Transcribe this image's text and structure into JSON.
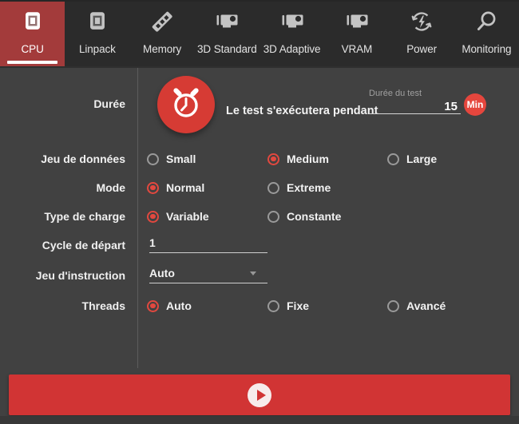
{
  "app": {
    "name": "stress-test-tool"
  },
  "colors": {
    "tab_selected_red": "#a33b3b",
    "accent_red": "#d13434",
    "alarm_red": "#d63b34",
    "min_button_red": "#e5463d",
    "radio_red": "#e2483f",
    "background": "#414141",
    "tabbar_background": "#2b2b2b"
  },
  "tabs": [
    {
      "label": "CPU",
      "icon": "cpu-chip",
      "selected": true
    },
    {
      "label": "Linpack",
      "icon": "chip",
      "selected": false
    },
    {
      "label": "Memory",
      "icon": "ram-stick",
      "selected": false
    },
    {
      "label": "3D Standard",
      "icon": "gpu-card",
      "selected": false
    },
    {
      "label": "3D Adaptive",
      "icon": "gpu-card",
      "selected": false
    },
    {
      "label": "VRAM",
      "icon": "gpu-card",
      "selected": false
    },
    {
      "label": "Power",
      "icon": "power-cycle",
      "selected": false
    },
    {
      "label": "Monitoring",
      "icon": "magnifier",
      "selected": false
    }
  ],
  "form": {
    "duration": {
      "label": "Durée",
      "description": "Le test s'exécutera pendant",
      "field_label": "Durée du test",
      "value": "15",
      "unit": "Min"
    },
    "rows": [
      {
        "label": "Jeu de données",
        "type": "radio",
        "options": [
          {
            "label": "Small",
            "selected": false
          },
          {
            "label": "Medium",
            "selected": true
          },
          {
            "label": "Large",
            "selected": false
          }
        ]
      },
      {
        "label": "Mode",
        "type": "radio",
        "options": [
          {
            "label": "Normal",
            "selected": true
          },
          {
            "label": "Extreme",
            "selected": false
          }
        ]
      },
      {
        "label": "Type de charge",
        "type": "radio",
        "options": [
          {
            "label": "Variable",
            "selected": true
          },
          {
            "label": "Constante",
            "selected": false
          }
        ]
      },
      {
        "label": "Cycle de départ",
        "type": "input",
        "value": "1"
      },
      {
        "label": "Jeu d'instruction",
        "type": "select",
        "value": "Auto"
      },
      {
        "label": "Threads",
        "type": "radio",
        "options": [
          {
            "label": "Auto",
            "selected": true
          },
          {
            "label": "Fixe",
            "selected": false
          },
          {
            "label": "Avancé",
            "selected": false
          }
        ]
      }
    ]
  }
}
